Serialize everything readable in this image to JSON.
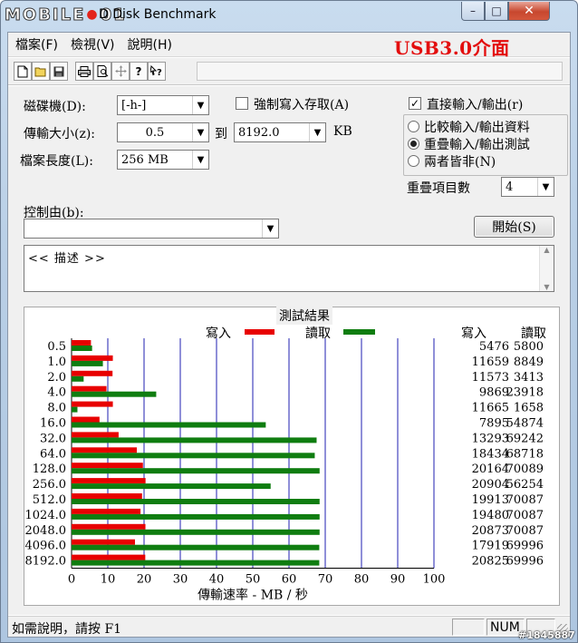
{
  "window": {
    "logo_left": "MOBILE",
    "logo_dot": "●",
    "logo_right": "01",
    "title": "系統管 - ATTO Disk Benchmark",
    "visible_title_tail": "D Disk Benchmark",
    "minimize_glyph": "–",
    "maximize_glyph": "□",
    "close_glyph": "✕"
  },
  "menu": {
    "items": [
      "檔案(F)",
      "檢視(V)",
      "說明(H)"
    ]
  },
  "annotation": {
    "text": "USB3.0介面",
    "color": "#e30d0d"
  },
  "toolbar": {
    "icons": [
      "new-file-icon",
      "open-folder-icon",
      "save-icon",
      "print-icon",
      "print-preview-icon",
      "move-icon",
      "help-icon",
      "context-help-icon"
    ],
    "glyphs": [
      "🗋",
      "📂",
      "💾",
      "🖨",
      "🔍",
      "✜",
      "?",
      "↗?"
    ]
  },
  "form": {
    "drive_label": "磁碟機(D):",
    "drive_value": "[-h-]",
    "force_write_label": "強制寫入存取(A)",
    "force_write_checked": false,
    "direct_io_label": "直接輸入/輸出(r)",
    "direct_io_checked": true,
    "transfer_label": "傳輸大小(z):",
    "transfer_from": "0.5",
    "to_label": "到",
    "transfer_to": "8192.0",
    "unit_label": "KB",
    "file_length_label": "檔案長度(L):",
    "file_length_value": "256 MB",
    "radio_options": [
      {
        "label": "比較輸入/輸出資料",
        "selected": false
      },
      {
        "label": "重疊輸入/輸出測試",
        "selected": true
      },
      {
        "label": "兩者皆非(N)",
        "selected": false
      }
    ],
    "queue_label": "重疊項目數",
    "queue_value": "4",
    "controlled_by_label": "控制由(b):",
    "controlled_by_value": "",
    "start_button": "開始(S)",
    "description": "<<   描述   >>"
  },
  "results": {
    "title": "測試結果",
    "legend_write": "寫入",
    "legend_read": "讀取",
    "col_write": "寫入",
    "col_read": "讀取",
    "xlabel": "傳輸速率 - MB / 秒"
  },
  "chart_data": {
    "type": "bar",
    "orientation": "horizontal",
    "categories": [
      "0.5",
      "1.0",
      "2.0",
      "4.0",
      "8.0",
      "16.0",
      "32.0",
      "64.0",
      "128.0",
      "256.0",
      "512.0",
      "1024.0",
      "2048.0",
      "4096.0",
      "8192.0"
    ],
    "series": [
      {
        "name": "寫入",
        "color": "#e80000",
        "values": [
          5476,
          11659,
          11573,
          9869,
          11665,
          7895,
          13293,
          18434,
          20164,
          20904,
          19913,
          19480,
          20873,
          17919,
          20825
        ]
      },
      {
        "name": "讀取",
        "color": "#0f7d10",
        "values": [
          5800,
          8849,
          3413,
          23918,
          1658,
          54874,
          69242,
          68718,
          70089,
          56254,
          70087,
          70087,
          70087,
          69996,
          69996
        ]
      }
    ],
    "bar_value_unit": "KB/s",
    "axis_unit": "MB/s",
    "xticks": [
      0,
      10,
      20,
      30,
      40,
      50,
      60,
      70,
      80,
      90,
      100
    ],
    "xlim": [
      0,
      100
    ],
    "xlabel": "傳輸速率 - MB / 秒",
    "legend": "top"
  },
  "status": {
    "help_text": "如需說明，請按 F1",
    "num_indicator": "NUM"
  },
  "watermark": "#1845887"
}
